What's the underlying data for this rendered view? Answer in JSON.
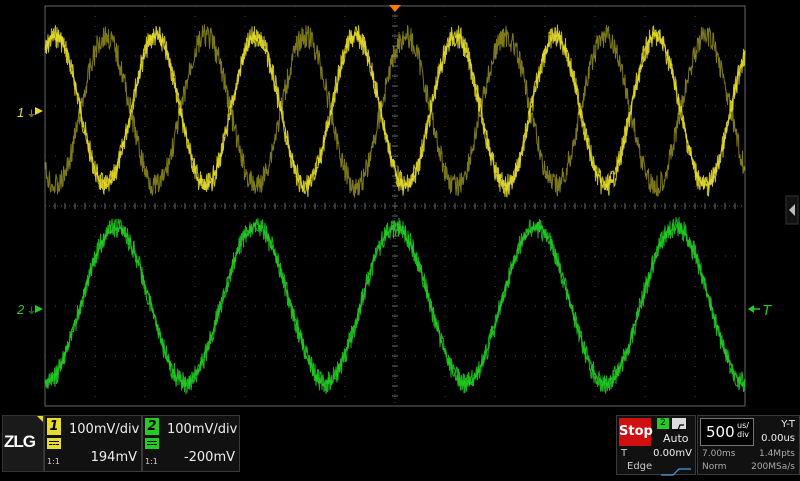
{
  "screen": {
    "logo": "ZLG",
    "channels": [
      {
        "number": "1",
        "marker": "1",
        "scale": "100mV/div",
        "offset": "194mV",
        "probe": "1:1",
        "color": "#e6dc2c",
        "coupling": "DC"
      },
      {
        "number": "2",
        "marker": "2",
        "scale": "100mV/div",
        "offset": "-200mV",
        "probe": "1:1",
        "color": "#22cc22",
        "coupling": "DC"
      }
    ],
    "run_state": "Stop",
    "trigger": {
      "source": "2",
      "mode": "Auto",
      "label": "T",
      "level": "0.00mV",
      "type": "Edge",
      "marker": "T"
    },
    "timebase": {
      "value": "500",
      "unit_top": "us/",
      "unit_bottom": "div",
      "delay": "7.00ms",
      "memory": "1.4Mpts",
      "acq_mode": "Norm",
      "sample_rate": "200MSa/s"
    },
    "display_mode": "Y-T",
    "horizontal_position": "0.00us",
    "colors": {
      "ch1": "#e6dc2c",
      "ch2": "#22cc22",
      "stop": "#d01010",
      "grid": "#4a4a4a",
      "trigger_marker": "#ff7a00"
    },
    "waveforms": {
      "ch1_periods_on_screen": 7,
      "ch1_two_traces_antiphase": true,
      "ch2_periods_on_screen": 5
    }
  }
}
